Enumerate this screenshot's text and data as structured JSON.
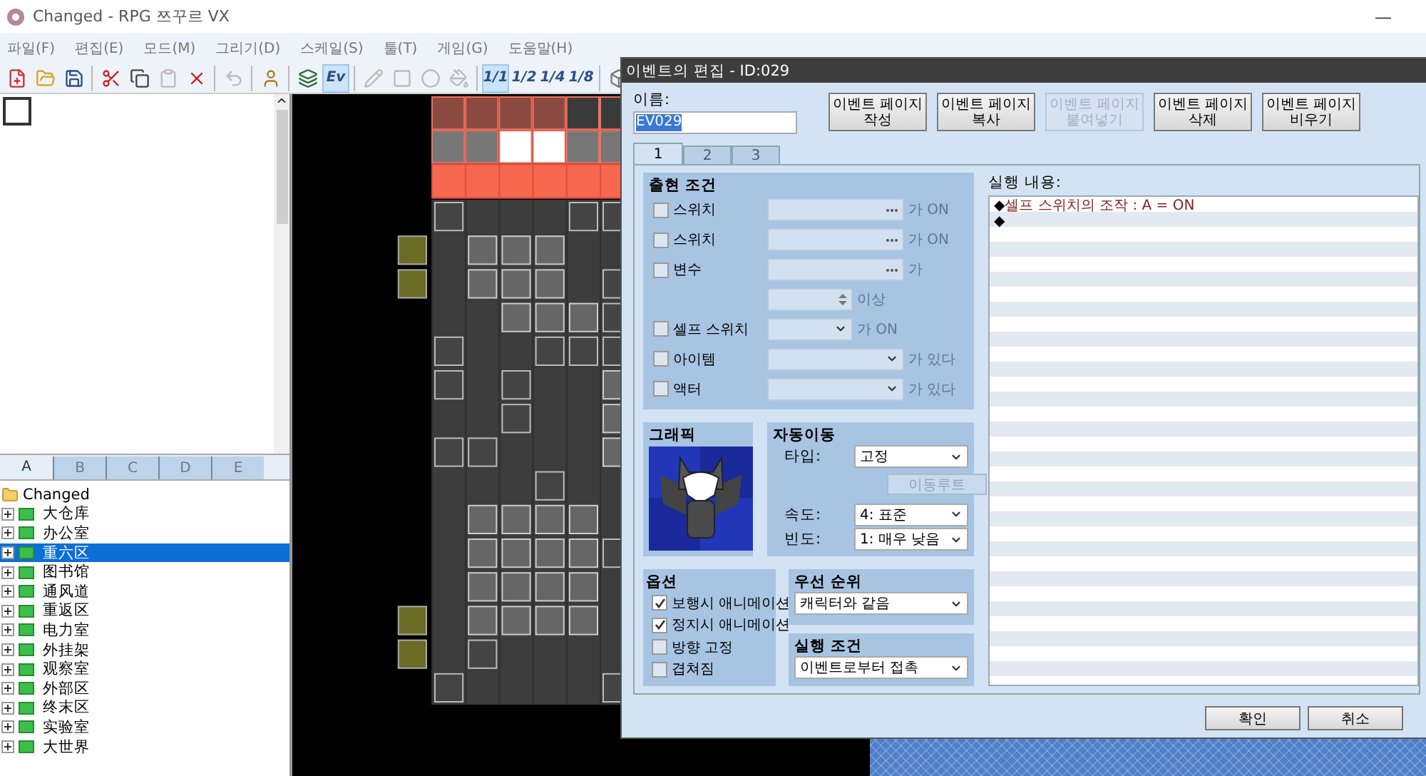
{
  "window": {
    "title": "Changed - RPG 쯔꾸르 VX",
    "minimize": "—"
  },
  "menu": [
    "파일(F)",
    "편집(E)",
    "모드(M)",
    "그리기(D)",
    "스케일(S)",
    "툴(T)",
    "게임(G)",
    "도움말(H)"
  ],
  "toolbar": [
    {
      "kind": "icon",
      "disabled": false
    },
    {
      "kind": "icon",
      "disabled": false
    },
    {
      "kind": "icon",
      "disabled": false
    },
    {
      "kind": "separator"
    },
    {
      "kind": "icon",
      "disabled": false
    },
    {
      "kind": "icon",
      "disabled": false
    },
    {
      "kind": "icon",
      "disabled": true
    },
    {
      "kind": "icon",
      "disabled": false
    },
    {
      "kind": "separator"
    },
    {
      "kind": "icon",
      "disabled": true
    },
    {
      "kind": "separator"
    },
    {
      "kind": "icon",
      "disabled": false
    },
    {
      "kind": "separator"
    },
    {
      "kind": "icon",
      "disabled": false
    },
    {
      "kind": "text",
      "label": "Ev",
      "selected": true
    },
    {
      "kind": "separator"
    },
    {
      "kind": "icon",
      "disabled": true
    },
    {
      "kind": "icon",
      "disabled": true
    },
    {
      "kind": "icon",
      "disabled": true
    },
    {
      "kind": "icon",
      "disabled": true
    },
    {
      "kind": "separator"
    },
    {
      "kind": "text",
      "label": "1/1",
      "selected": true
    },
    {
      "kind": "text",
      "label": "1/2",
      "selected": false
    },
    {
      "kind": "text",
      "label": "1/4",
      "selected": false
    },
    {
      "kind": "text",
      "label": "1/8",
      "selected": false
    },
    {
      "kind": "separator"
    },
    {
      "kind": "icon",
      "disabled": false
    }
  ],
  "tileset_tabs": [
    {
      "label": "A",
      "selected": true
    },
    {
      "label": "B",
      "selected": false
    },
    {
      "label": "C",
      "selected": false
    },
    {
      "label": "D",
      "selected": false
    },
    {
      "label": "E",
      "selected": false
    }
  ],
  "map_tree": {
    "label": "Changed",
    "children": [
      {
        "label": "大仓库",
        "expanded": false,
        "selected": false
      },
      {
        "label": "办公室",
        "expanded": false,
        "selected": false
      },
      {
        "label": "重六区",
        "expanded": false,
        "selected": true
      },
      {
        "label": "图书馆",
        "expanded": false,
        "selected": false
      },
      {
        "label": "通风道",
        "expanded": false,
        "selected": false
      },
      {
        "label": "重返区",
        "expanded": false,
        "selected": false
      },
      {
        "label": "电力室",
        "expanded": false,
        "selected": false
      },
      {
        "label": "外挂架",
        "expanded": false,
        "selected": false
      },
      {
        "label": "观察室",
        "expanded": false,
        "selected": false
      },
      {
        "label": "外部区",
        "expanded": false,
        "selected": false
      },
      {
        "label": "终末区",
        "expanded": false,
        "selected": false
      },
      {
        "label": "实验室",
        "expanded": false,
        "selected": false
      },
      {
        "label": "大世界",
        "expanded": false,
        "selected": false
      }
    ]
  },
  "dialog": {
    "title": "이벤트의 편집 - ID:029",
    "name_label": "이름:",
    "name_value": "EV029",
    "page_buttons": [
      {
        "lines": [
          "이벤트 페이지",
          "작성"
        ],
        "disabled": false
      },
      {
        "lines": [
          "이벤트 페이지",
          "복사"
        ],
        "disabled": false
      },
      {
        "lines": [
          "이벤트 페이지",
          "붙여넣기"
        ],
        "disabled": true
      },
      {
        "lines": [
          "이벤트 페이지",
          "삭제"
        ],
        "disabled": false
      },
      {
        "lines": [
          "이벤트 페이지",
          "비우기"
        ],
        "disabled": false
      }
    ],
    "tabs": [
      {
        "label": "1",
        "selected": true
      },
      {
        "label": "2",
        "selected": false
      },
      {
        "label": "3",
        "selected": false
      }
    ],
    "conditions": {
      "title": "출현 조건",
      "rows": [
        {
          "kind": "dots",
          "label": "스위치",
          "checked": false,
          "suffix": "가 ON"
        },
        {
          "kind": "dots",
          "label": "스위치",
          "checked": false,
          "suffix": "가 ON"
        },
        {
          "kind": "dots",
          "label": "변수",
          "checked": false,
          "suffix": "가"
        },
        {
          "kind": "spin",
          "suffix": "이상"
        },
        {
          "kind": "short-combo",
          "label": "셀프 스위치",
          "checked": false,
          "suffix": "가 ON"
        },
        {
          "kind": "combo",
          "label": "아이템",
          "checked": false,
          "suffix": "가 있다"
        },
        {
          "kind": "combo",
          "label": "액터",
          "checked": false,
          "suffix": "가 있다"
        }
      ]
    },
    "graphic": {
      "title": "그래픽"
    },
    "auto_move": {
      "title": "자동이동",
      "type_label": "타입:",
      "type_value": "고정",
      "route_button": {
        "label": "이동루트",
        "disabled": true
      },
      "speed_label": "속도:",
      "speed_value": "4: 표준",
      "freq_label": "빈도:",
      "freq_value": "1: 매우 낮음"
    },
    "options": {
      "title": "옵션",
      "items": [
        {
          "label": "보행시 애니메이션",
          "checked": true
        },
        {
          "label": "정지시 애니메이션",
          "checked": true
        },
        {
          "label": "방향 고정",
          "checked": false
        },
        {
          "label": "겹쳐짐",
          "checked": false
        }
      ]
    },
    "priority": {
      "title": "우선 순위",
      "value": "캐릭터와 같음"
    },
    "trigger": {
      "title": "실행 조건",
      "value": "이벤트로부터 접촉"
    },
    "commands": {
      "label": "실행 내용:",
      "lines": [
        {
          "marker": "◆",
          "text": "셀프 스위치의 조작 : A = ON"
        },
        {
          "marker": "◆"
        }
      ]
    },
    "buttons": [
      "확인",
      "취소"
    ]
  }
}
